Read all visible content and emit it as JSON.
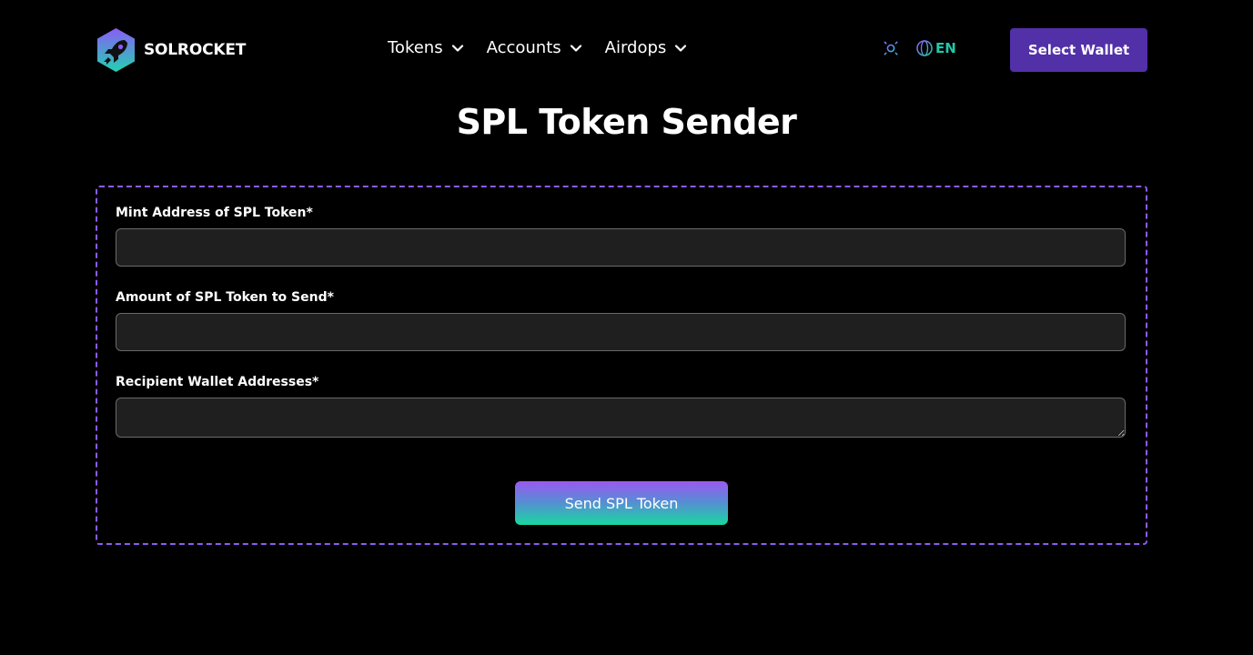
{
  "brand": {
    "name": "SOLROCKET",
    "logo_icon": "rocket-hexagon-icon",
    "colors": {
      "hex_top": "#8a5cf6",
      "hex_bottom": "#22d3b0"
    }
  },
  "nav": {
    "items": [
      {
        "label": "Tokens",
        "icon": "chevron-down-icon"
      },
      {
        "label": "Accounts",
        "icon": "chevron-down-icon"
      },
      {
        "label": "Airdops",
        "icon": "chevron-down-icon"
      }
    ]
  },
  "header": {
    "theme_icon": "sun-icon",
    "language_icon": "globe-icon",
    "language_label": "EN",
    "wallet_button_label": "Select Wallet",
    "accent_color": "#5230a8"
  },
  "page": {
    "title": "SPL Token Sender"
  },
  "form": {
    "mint_label": "Mint Address of SPL Token*",
    "mint_value": "",
    "amount_label": "Amount of SPL Token to Send*",
    "amount_value": "",
    "recipients_label": "Recipient Wallet Addresses*",
    "recipients_value": "",
    "submit_label": "Send SPL Token",
    "border_color": "#8c5cf0"
  }
}
